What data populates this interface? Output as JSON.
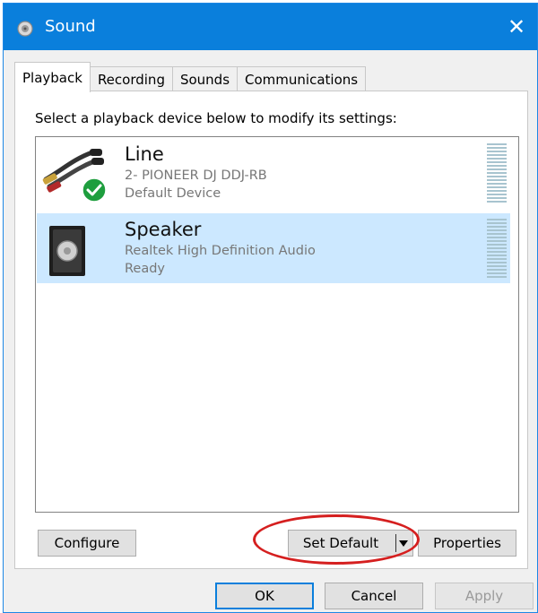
{
  "window": {
    "title": "Sound",
    "close_glyph": "✕",
    "accent": "#0a7fdc"
  },
  "tabs": [
    {
      "label": "Playback",
      "active": true
    },
    {
      "label": "Recording",
      "active": false
    },
    {
      "label": "Sounds",
      "active": false
    },
    {
      "label": "Communications",
      "active": false
    }
  ],
  "panel": {
    "instruction": "Select a playback device below to modify its settings:"
  },
  "devices": [
    {
      "name": "Line",
      "description": "2- PIONEER DJ DDJ-RB",
      "status": "Default Device",
      "icon": "rca-cable-icon",
      "is_default": true,
      "selected": false
    },
    {
      "name": "Speaker",
      "description": "Realtek High Definition Audio",
      "status": "Ready",
      "icon": "speaker-icon",
      "is_default": false,
      "selected": true
    }
  ],
  "panel_buttons": {
    "configure": "Configure",
    "set_default": "Set Default",
    "properties": "Properties"
  },
  "dialog_buttons": {
    "ok": "OK",
    "cancel": "Cancel",
    "apply": "Apply"
  },
  "annotation_color": "#d51f1f"
}
